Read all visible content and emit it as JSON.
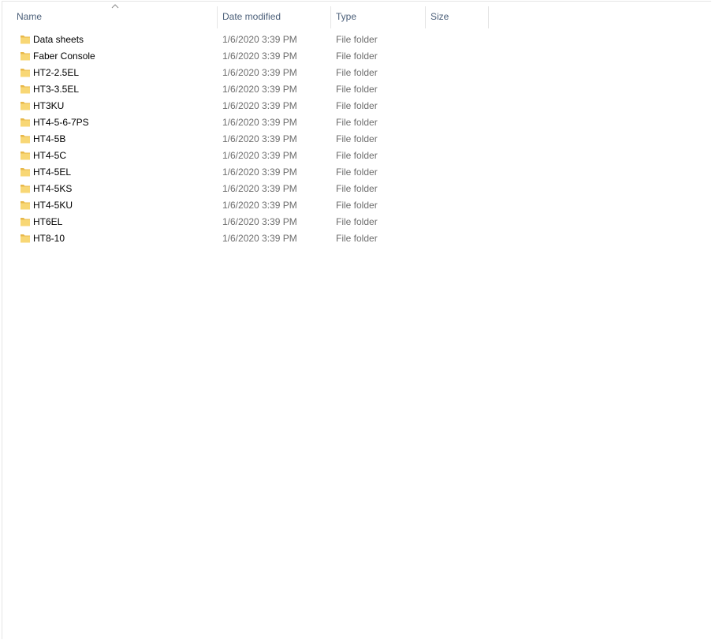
{
  "columns": {
    "name": "Name",
    "date": "Date modified",
    "type": "Type",
    "size": "Size"
  },
  "sort": {
    "column": "name",
    "icon": "chevron-up-icon"
  },
  "colors": {
    "header_text": "#4c607a",
    "secondary_text": "#6d6d6d",
    "folder_yellow": "#f8d775",
    "folder_dark": "#e8b84a"
  },
  "files": [
    {
      "name": "Data sheets",
      "date": "1/6/2020 3:39 PM",
      "type": "File folder",
      "size": "",
      "icon": "folder-icon"
    },
    {
      "name": "Faber Console",
      "date": "1/6/2020 3:39 PM",
      "type": "File folder",
      "size": "",
      "icon": "folder-icon"
    },
    {
      "name": "HT2-2.5EL",
      "date": "1/6/2020 3:39 PM",
      "type": "File folder",
      "size": "",
      "icon": "folder-icon"
    },
    {
      "name": "HT3-3.5EL",
      "date": "1/6/2020 3:39 PM",
      "type": "File folder",
      "size": "",
      "icon": "folder-icon"
    },
    {
      "name": "HT3KU",
      "date": "1/6/2020 3:39 PM",
      "type": "File folder",
      "size": "",
      "icon": "folder-icon"
    },
    {
      "name": "HT4-5-6-7PS",
      "date": "1/6/2020 3:39 PM",
      "type": "File folder",
      "size": "",
      "icon": "folder-icon"
    },
    {
      "name": "HT4-5B",
      "date": "1/6/2020 3:39 PM",
      "type": "File folder",
      "size": "",
      "icon": "folder-icon"
    },
    {
      "name": "HT4-5C",
      "date": "1/6/2020 3:39 PM",
      "type": "File folder",
      "size": "",
      "icon": "folder-icon"
    },
    {
      "name": "HT4-5EL",
      "date": "1/6/2020 3:39 PM",
      "type": "File folder",
      "size": "",
      "icon": "folder-icon"
    },
    {
      "name": "HT4-5KS",
      "date": "1/6/2020 3:39 PM",
      "type": "File folder",
      "size": "",
      "icon": "folder-icon"
    },
    {
      "name": "HT4-5KU",
      "date": "1/6/2020 3:39 PM",
      "type": "File folder",
      "size": "",
      "icon": "folder-icon"
    },
    {
      "name": "HT6EL",
      "date": "1/6/2020 3:39 PM",
      "type": "File folder",
      "size": "",
      "icon": "folder-icon"
    },
    {
      "name": "HT8-10",
      "date": "1/6/2020 3:39 PM",
      "type": "File folder",
      "size": "",
      "icon": "folder-icon"
    }
  ]
}
